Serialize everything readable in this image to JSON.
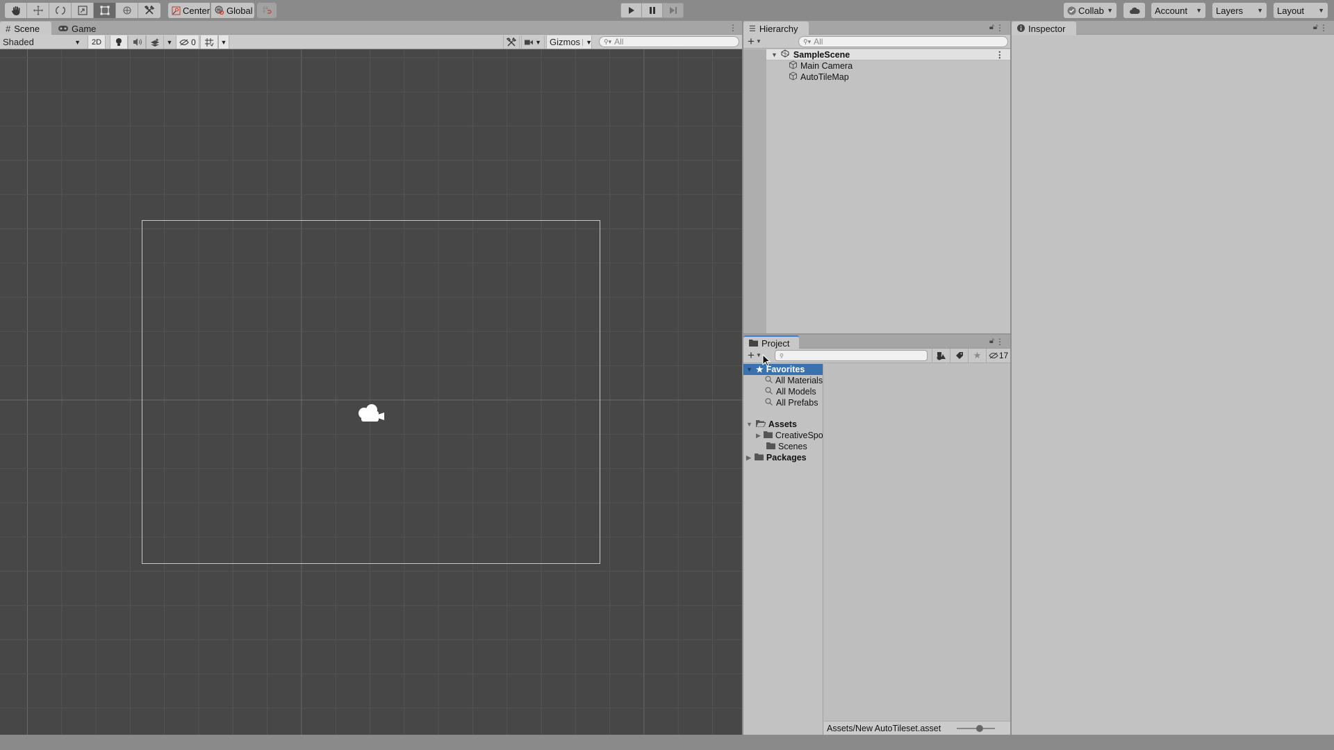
{
  "toolbar": {
    "tools": [
      {
        "name": "hand-tool",
        "icon": "hand-icon",
        "active": false
      },
      {
        "name": "move-tool",
        "icon": "move-icon",
        "active": false
      },
      {
        "name": "rotate-tool",
        "icon": "rotate-icon",
        "active": false
      },
      {
        "name": "scale-tool",
        "icon": "scale-icon",
        "active": false
      },
      {
        "name": "rect-tool",
        "icon": "rect-transform-icon",
        "active": true
      },
      {
        "name": "transform-tool",
        "icon": "transform-icon",
        "active": false
      },
      {
        "name": "custom-tool",
        "icon": "tools-icon",
        "active": false
      }
    ],
    "pivot_mode": "Center",
    "pivot_rotation": "Global",
    "snap_icon": "grid-snap-icon",
    "play": "play-icon",
    "pause": "pause-icon",
    "step": "step-icon",
    "collab_label": "Collab",
    "cloud_icon": "cloud-icon",
    "account_label": "Account",
    "layers_label": "Layers",
    "layout_label": "Layout"
  },
  "scene": {
    "tabs": [
      {
        "label": "Scene",
        "icon": "grid-hash-icon",
        "active": true
      },
      {
        "label": "Game",
        "icon": "gamepad-icon",
        "active": false
      }
    ],
    "draw_mode": "Shaded",
    "toggle_2d": "2D",
    "hidden_count": "0",
    "gizmos_label": "Gizmos",
    "search_placeholder": "All",
    "camera_icon": "camera-gizmo-icon"
  },
  "hierarchy": {
    "title": "Hierarchy",
    "search_placeholder": "All",
    "scene_name": "SampleScene",
    "items": [
      {
        "label": "Main Camera",
        "icon": "gameobject-cube-icon"
      },
      {
        "label": "AutoTileMap",
        "icon": "gameobject-cube-icon"
      }
    ]
  },
  "project": {
    "title": "Project",
    "search_value": "",
    "hidden_packages_count": "17",
    "tree": [
      {
        "label": "Favorites",
        "type": "favorites",
        "expanded": true,
        "selected": true,
        "depth": 0
      },
      {
        "label": "All Materials",
        "type": "search",
        "depth": 1
      },
      {
        "label": "All Models",
        "type": "search",
        "depth": 1
      },
      {
        "label": "All Prefabs",
        "type": "search",
        "depth": 1
      },
      {
        "label": "Assets",
        "type": "folder-open",
        "expanded": true,
        "depth": 0
      },
      {
        "label": "CreativeSpore",
        "type": "folder",
        "expanded": false,
        "depth": 1
      },
      {
        "label": "Scenes",
        "type": "folder",
        "depth": 1
      },
      {
        "label": "Packages",
        "type": "folder",
        "expanded": false,
        "depth": 0
      }
    ],
    "status_path": "Assets/New AutoTileset.asset",
    "icon_size_slider": 0.6
  },
  "inspector": {
    "title": "Inspector"
  }
}
